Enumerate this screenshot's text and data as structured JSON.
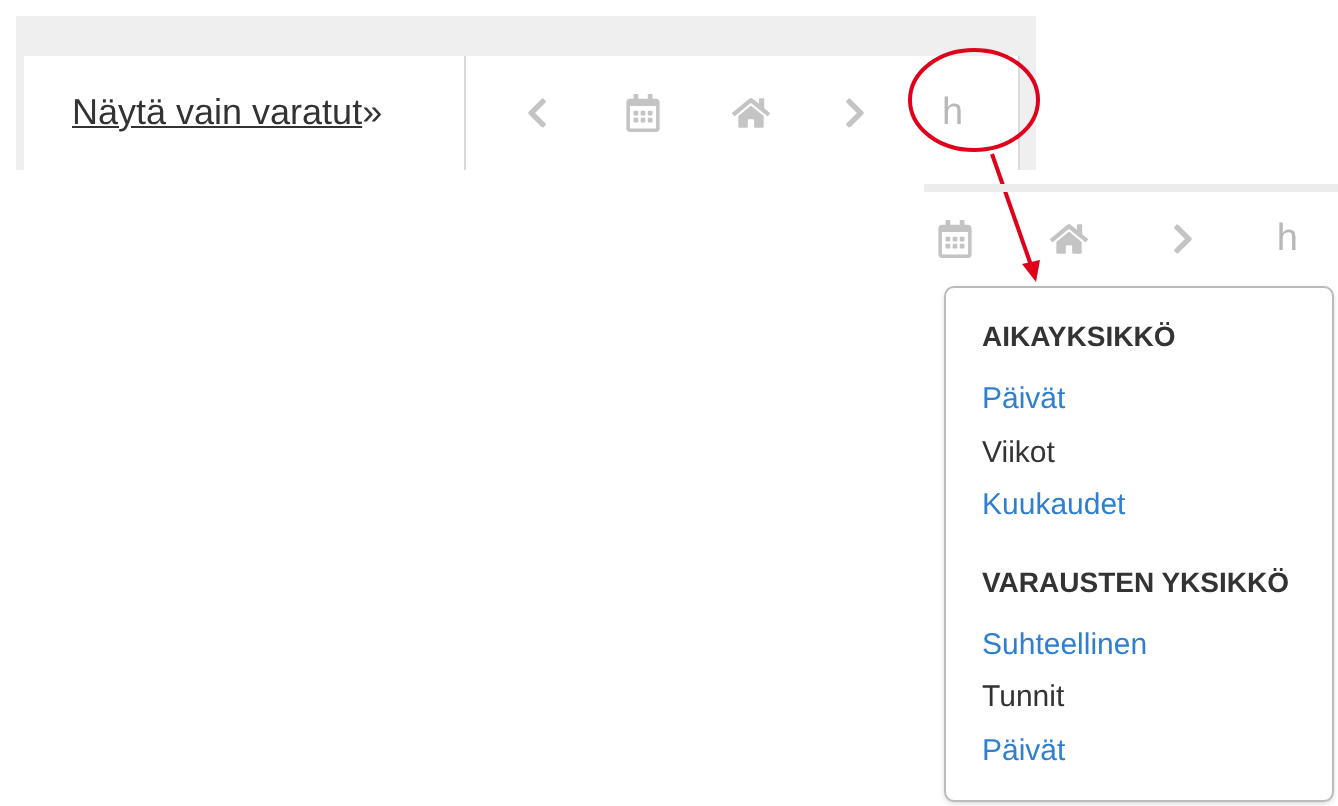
{
  "toolbar": {
    "filter_link": "Näytä vain varatut",
    "filter_chevron": "»",
    "nav": [
      {
        "kind": "prev"
      },
      {
        "kind": "calendar"
      },
      {
        "kind": "home"
      },
      {
        "kind": "next"
      },
      {
        "kind": "text",
        "label": "h"
      }
    ]
  },
  "zoomed_toolbar": {
    "nav": [
      {
        "kind": "calendar"
      },
      {
        "kind": "home"
      },
      {
        "kind": "next"
      },
      {
        "kind": "text",
        "label": "h"
      }
    ]
  },
  "menu": {
    "sections": [
      {
        "heading": "AIKAYKSIKKÖ",
        "items": [
          {
            "label": "Päivät",
            "selected": false
          },
          {
            "label": "Viikot",
            "selected": true
          },
          {
            "label": "Kuukaudet",
            "selected": false
          }
        ]
      },
      {
        "heading": "VARAUSTEN YKSIKKÖ",
        "items": [
          {
            "label": "Suhteellinen",
            "selected": false
          },
          {
            "label": "Tunnit",
            "selected": true
          },
          {
            "label": "Päivät",
            "selected": false
          }
        ]
      }
    ]
  }
}
